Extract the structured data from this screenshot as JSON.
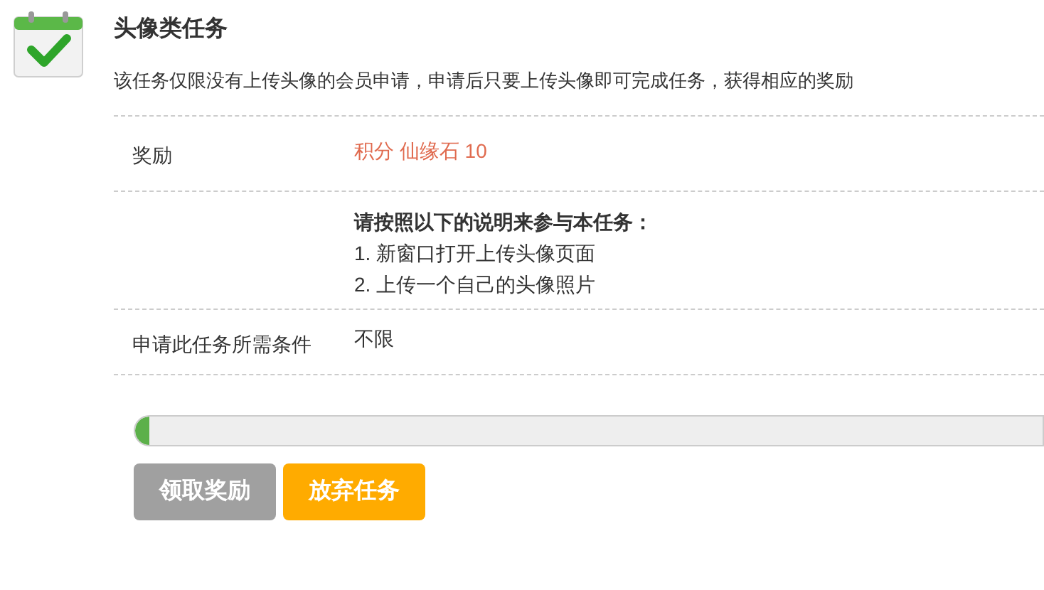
{
  "task": {
    "title": "头像类任务",
    "description": "该任务仅限没有上传头像的会员申请，申请后只要上传头像即可完成任务，获得相应的奖励"
  },
  "rows": [
    {
      "kind": "reward",
      "label": "奖励",
      "value": "积分 仙缘石 10"
    },
    {
      "kind": "steps",
      "heading": "请按照以下的说明来参与本任务：",
      "steps": [
        "1. 新窗口打开上传头像页面",
        "2. 上传一个自己的头像照片"
      ]
    },
    {
      "kind": "text",
      "label": "申请此任务所需条件",
      "value": "不限"
    }
  ],
  "progress": {
    "level": 0.015
  },
  "buttons": [
    {
      "label": "领取奖励",
      "disabled": true
    },
    {
      "label": "放弃任务",
      "disabled": false
    }
  ]
}
